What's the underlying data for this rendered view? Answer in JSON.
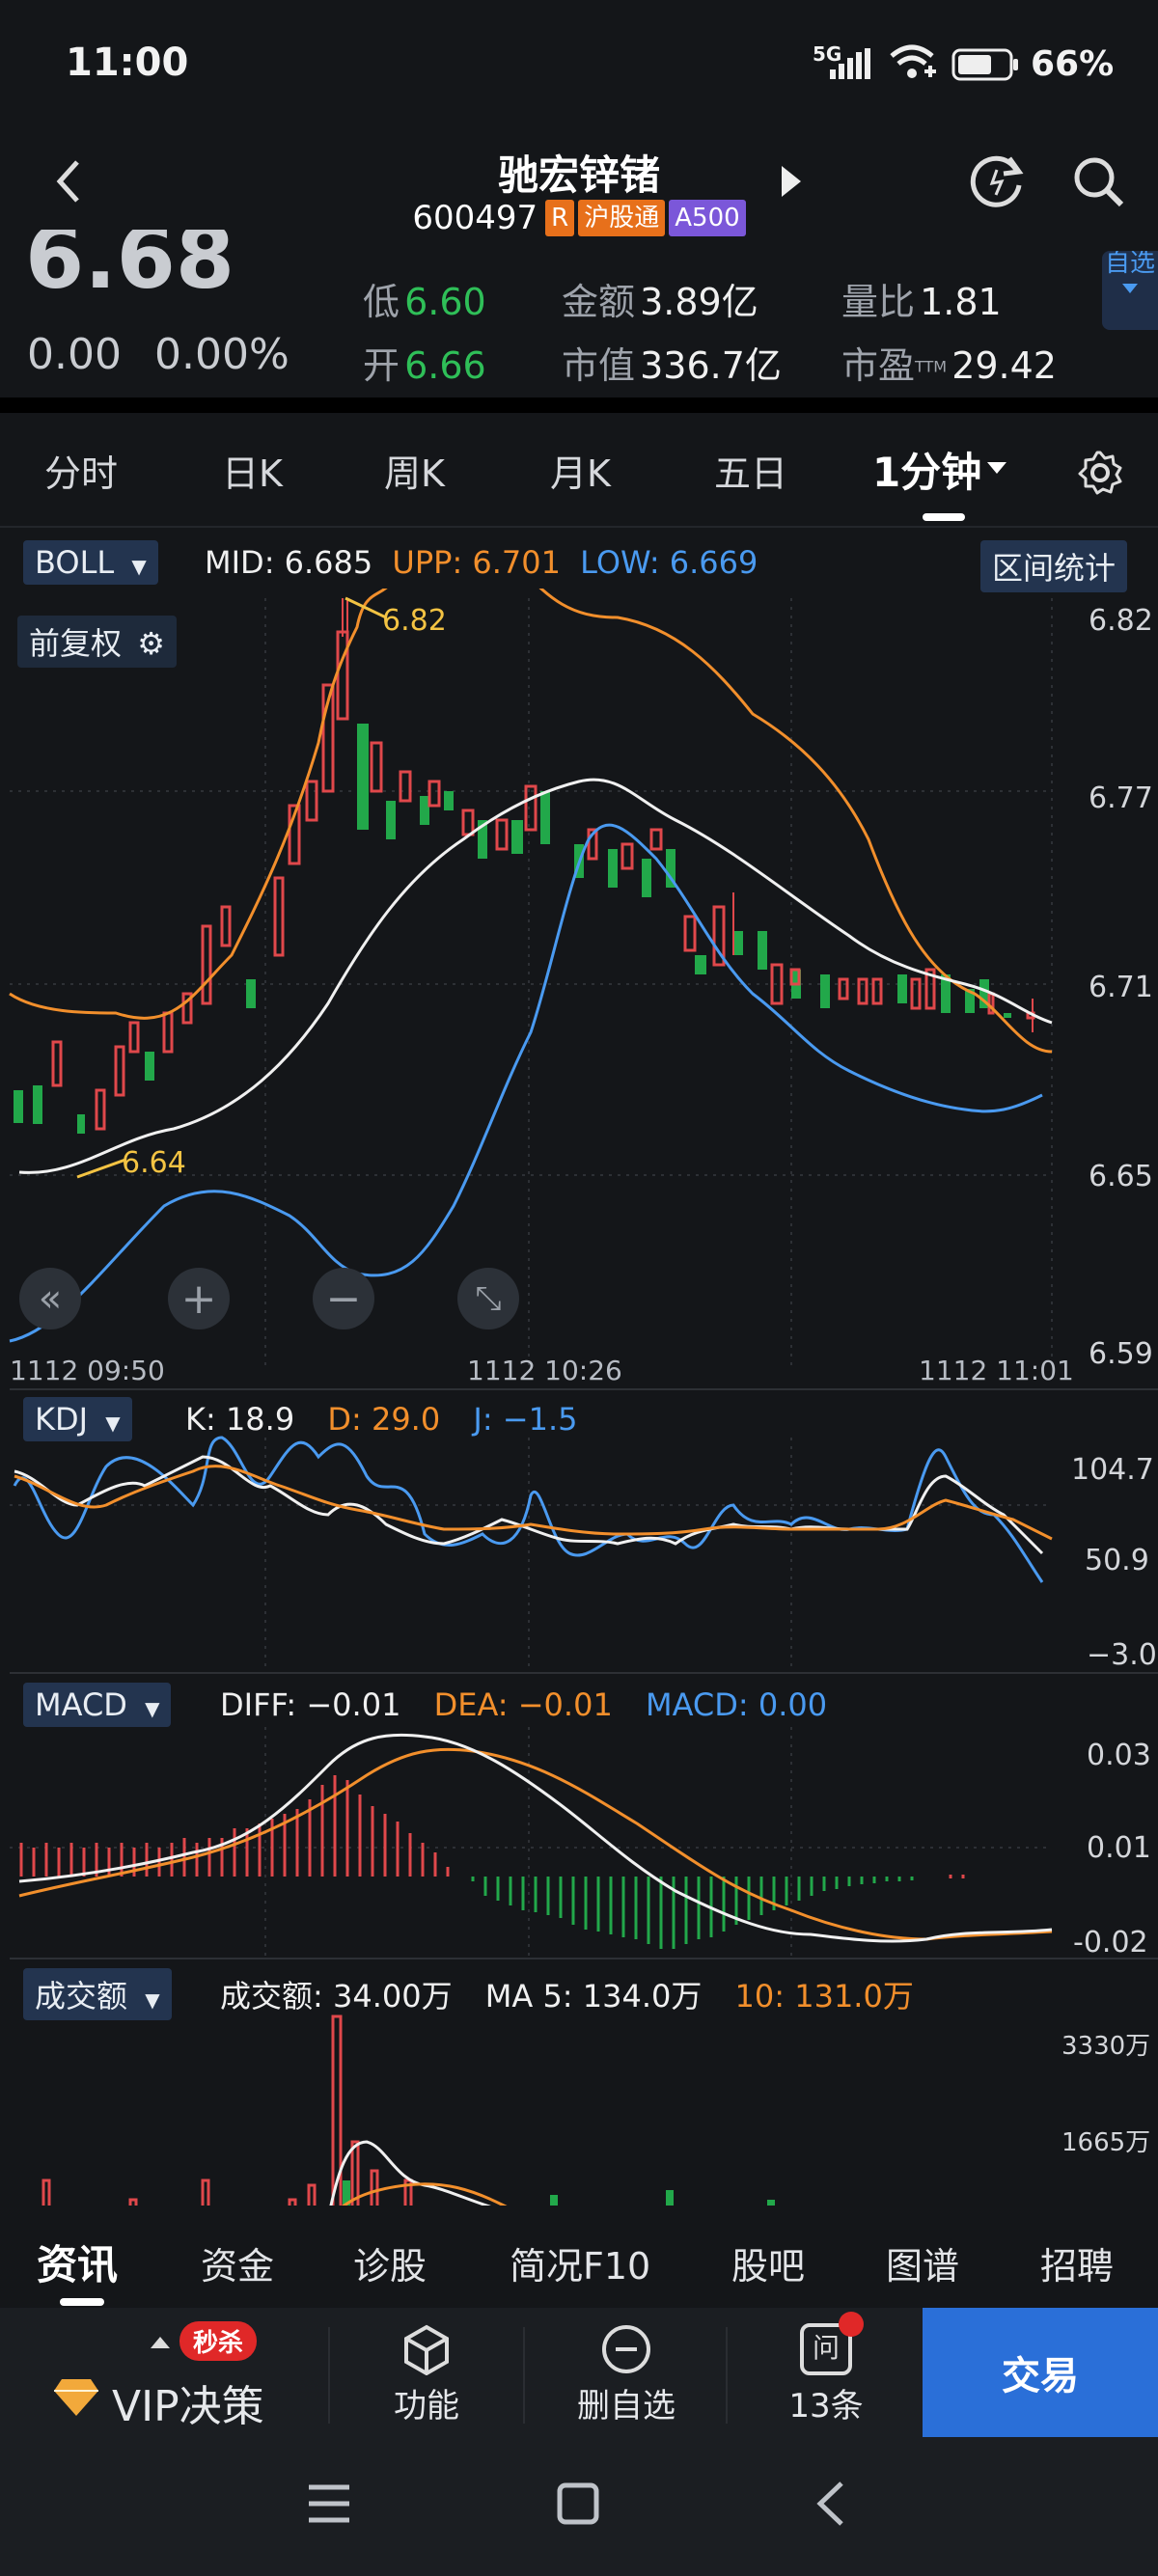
{
  "status_bar": {
    "time": "11:00",
    "network": "5G",
    "battery": "66%"
  },
  "header": {
    "stock_name": "驰宏锌锗",
    "stock_code": "600497",
    "tag_r": "R",
    "tag_hgt": "沪股通",
    "tag_a500": "A500",
    "side_button": "自选"
  },
  "quote": {
    "last_price": "6.68",
    "change": "0.00",
    "change_pct": "0.00%",
    "low_label": "低",
    "low": "6.60",
    "open_label": "开",
    "open": "6.66",
    "amount_label": "金额",
    "amount": "3.89亿",
    "mcap_label": "市值",
    "mcap": "336.7亿",
    "vol_ratio_label": "量比",
    "vol_ratio": "1.81",
    "pe_label": "市盈",
    "pe_sup": "TTM",
    "pe": "29.42"
  },
  "period_tabs": [
    "分时",
    "日K",
    "周K",
    "月K",
    "五日",
    "1分钟"
  ],
  "boll": {
    "tag": "BOLL",
    "mid_label": "MID:",
    "mid": "6.685",
    "upp_label": "UPP:",
    "upp": "6.701",
    "low_label": "LOW:",
    "low": "6.669",
    "range_button": "区间统计",
    "adjust_button": "前复权",
    "high_marker": "6.82",
    "low_marker": "6.64",
    "y_ticks": [
      "6.82",
      "6.77",
      "6.71",
      "6.65",
      "6.59"
    ],
    "x_ticks": [
      "1112  09:50",
      "1112  10:26",
      "1112  11:01"
    ]
  },
  "kdj": {
    "tag": "KDJ",
    "k_label": "K:",
    "k": "18.9",
    "d_label": "D:",
    "d": "29.0",
    "j_label": "J:",
    "j": "−1.5",
    "y_ticks": [
      "104.7",
      "50.9",
      "−3.0"
    ]
  },
  "macd": {
    "tag": "MACD",
    "diff_label": "DIFF:",
    "diff": "−0.01",
    "dea_label": "DEA:",
    "dea": "−0.01",
    "macd_label": "MACD:",
    "macd": "0.00",
    "y_ticks": [
      "0.03",
      "0.01",
      "-0.02"
    ]
  },
  "volume": {
    "tag": "成交额",
    "amt_label": "成交额:",
    "amt": "34.00万",
    "ma5_label": "MA 5:",
    "ma5": "134.0万",
    "ma10_label": "10:",
    "ma10": "131.0万",
    "y_ticks": [
      "3330万",
      "1665万"
    ]
  },
  "bottom_tabs": [
    "资讯",
    "资金",
    "诊股",
    "简况F10",
    "股吧",
    "图谱",
    "招聘"
  ],
  "bottom_bar": {
    "vip_badge": "秒杀",
    "vip_label": "VIP决策",
    "func_label": "功能",
    "remove_label": "删自选",
    "ask_label": "13条",
    "ask_icon_text": "问",
    "trade_label": "交易"
  },
  "chart_data": [
    {
      "type": "line",
      "title": "BOLL",
      "x": [
        "09:50",
        "10:26",
        "11:01"
      ],
      "ylim": [
        6.59,
        6.82
      ],
      "series": [
        {
          "name": "MID",
          "values": [
            6.655,
            6.787,
            6.685
          ]
        },
        {
          "name": "UPP",
          "values": [
            6.71,
            6.82,
            6.701
          ]
        },
        {
          "name": "LOW",
          "values": [
            6.595,
            6.75,
            6.669
          ]
        }
      ]
    },
    {
      "type": "line",
      "title": "KDJ",
      "ylim": [
        -3.0,
        104.7
      ],
      "series": [
        {
          "name": "K",
          "values": [
            18.9
          ]
        },
        {
          "name": "D",
          "values": [
            29.0
          ]
        },
        {
          "name": "J",
          "values": [
            -1.5
          ]
        }
      ]
    },
    {
      "type": "line",
      "title": "MACD",
      "ylim": [
        -0.02,
        0.03
      ],
      "series": [
        {
          "name": "DIFF",
          "values": [
            -0.01
          ]
        },
        {
          "name": "DEA",
          "values": [
            -0.01
          ]
        },
        {
          "name": "MACD",
          "values": [
            0.0
          ]
        }
      ]
    },
    {
      "type": "bar",
      "title": "成交额",
      "ylim": [
        0,
        3330
      ],
      "series": [
        {
          "name": "成交额",
          "values": [
            34.0
          ]
        },
        {
          "name": "MA 5",
          "values": [
            134.0
          ]
        },
        {
          "name": "10",
          "values": [
            131.0
          ]
        }
      ]
    }
  ]
}
